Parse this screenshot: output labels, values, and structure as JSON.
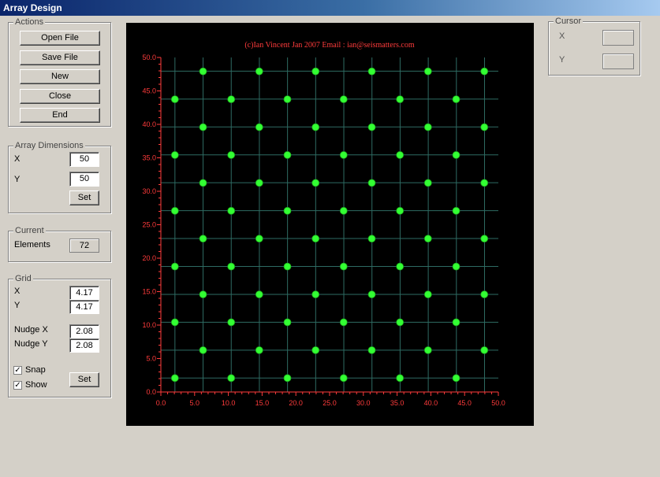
{
  "window": {
    "title": "Array Design"
  },
  "actions": {
    "legend": "Actions",
    "open_label": "Open File",
    "save_label": "Save File",
    "new_label": "New",
    "close_label": "Close",
    "end_label": "End"
  },
  "array_dimensions": {
    "legend": "Array Dimensions",
    "x_label": "X",
    "x_value": "50",
    "y_label": "Y",
    "y_value": "50",
    "set_label": "Set"
  },
  "current": {
    "legend": "Current",
    "elements_label": "Elements",
    "elements_value": "72"
  },
  "grid": {
    "legend": "Grid",
    "x_label": "X",
    "x_value": "4.17",
    "y_label": "Y",
    "y_value": "4.17",
    "nudge_x_label": "Nudge X",
    "nudge_x_value": "2.08",
    "nudge_y_label": "Nudge Y",
    "nudge_y_value": "2.08",
    "snap_label": "Snap",
    "snap_checked": true,
    "show_label": "Show",
    "show_checked": true,
    "set_label": "Set"
  },
  "cursor": {
    "legend": "Cursor",
    "x_label": "X",
    "x_value": "",
    "y_label": "Y",
    "y_value": ""
  },
  "chart_data": {
    "type": "scatter",
    "title": "(c)Ian Vincent Jan 2007 Email : ian@seismatters.com",
    "xlabel": "",
    "ylabel": "",
    "xlim": [
      0,
      50
    ],
    "ylim": [
      0,
      50
    ],
    "xticks": [
      "0.0",
      "5.0",
      "10.0",
      "15.0",
      "20.0",
      "25.0",
      "30.0",
      "35.0",
      "40.0",
      "45.0",
      "50.0"
    ],
    "yticks": [
      "0.0",
      "5.0",
      "10.0",
      "15.0",
      "20.0",
      "25.0",
      "30.0",
      "35.0",
      "40.0",
      "45.0",
      "50.0"
    ],
    "grid": true,
    "grid_spacing": 4.17,
    "colors": {
      "background": "#000000",
      "axis": "#ff3b3b",
      "title": "#ff3b3b",
      "grid": "#2e6b63",
      "point": "#33ff33"
    },
    "points": [
      [
        6.25,
        47.92
      ],
      [
        14.58,
        47.92
      ],
      [
        22.92,
        47.92
      ],
      [
        31.25,
        47.92
      ],
      [
        39.58,
        47.92
      ],
      [
        47.92,
        47.92
      ],
      [
        2.08,
        43.75
      ],
      [
        10.42,
        43.75
      ],
      [
        18.75,
        43.75
      ],
      [
        27.08,
        43.75
      ],
      [
        35.42,
        43.75
      ],
      [
        43.75,
        43.75
      ],
      [
        6.25,
        39.58
      ],
      [
        14.58,
        39.58
      ],
      [
        22.92,
        39.58
      ],
      [
        31.25,
        39.58
      ],
      [
        39.58,
        39.58
      ],
      [
        47.92,
        39.58
      ],
      [
        2.08,
        35.42
      ],
      [
        10.42,
        35.42
      ],
      [
        18.75,
        35.42
      ],
      [
        27.08,
        35.42
      ],
      [
        35.42,
        35.42
      ],
      [
        43.75,
        35.42
      ],
      [
        6.25,
        31.25
      ],
      [
        14.58,
        31.25
      ],
      [
        22.92,
        31.25
      ],
      [
        31.25,
        31.25
      ],
      [
        39.58,
        31.25
      ],
      [
        47.92,
        31.25
      ],
      [
        2.08,
        27.08
      ],
      [
        10.42,
        27.08
      ],
      [
        18.75,
        27.08
      ],
      [
        27.08,
        27.08
      ],
      [
        35.42,
        27.08
      ],
      [
        43.75,
        27.08
      ],
      [
        6.25,
        22.92
      ],
      [
        14.58,
        22.92
      ],
      [
        22.92,
        22.92
      ],
      [
        31.25,
        22.92
      ],
      [
        39.58,
        22.92
      ],
      [
        47.92,
        22.92
      ],
      [
        2.08,
        18.75
      ],
      [
        10.42,
        18.75
      ],
      [
        18.75,
        18.75
      ],
      [
        27.08,
        18.75
      ],
      [
        35.42,
        18.75
      ],
      [
        43.75,
        18.75
      ],
      [
        6.25,
        14.58
      ],
      [
        14.58,
        14.58
      ],
      [
        22.92,
        14.58
      ],
      [
        31.25,
        14.58
      ],
      [
        39.58,
        14.58
      ],
      [
        47.92,
        14.58
      ],
      [
        2.08,
        10.42
      ],
      [
        10.42,
        10.42
      ],
      [
        18.75,
        10.42
      ],
      [
        27.08,
        10.42
      ],
      [
        35.42,
        10.42
      ],
      [
        43.75,
        10.42
      ],
      [
        6.25,
        6.25
      ],
      [
        14.58,
        6.25
      ],
      [
        22.92,
        6.25
      ],
      [
        31.25,
        6.25
      ],
      [
        39.58,
        6.25
      ],
      [
        47.92,
        6.25
      ],
      [
        2.08,
        2.08
      ],
      [
        10.42,
        2.08
      ],
      [
        18.75,
        2.08
      ],
      [
        27.08,
        2.08
      ],
      [
        35.42,
        2.08
      ],
      [
        43.75,
        2.08
      ]
    ]
  }
}
